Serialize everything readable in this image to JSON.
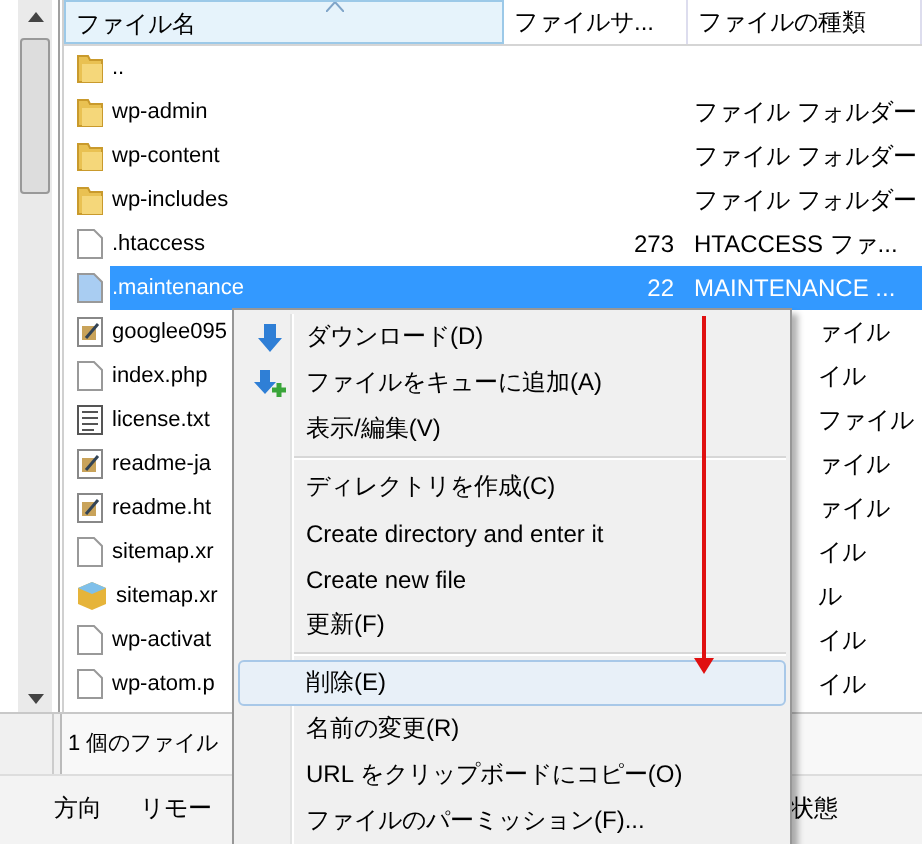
{
  "columns": [
    "ファイル名",
    "ファイルサ...",
    "ファイルの種類"
  ],
  "rows": [
    {
      "kind": "folder",
      "name": "..",
      "size": "",
      "type": "",
      "selected": false
    },
    {
      "kind": "folder",
      "name": "wp-admin",
      "size": "",
      "type": "ファイル フォルダー",
      "selected": false
    },
    {
      "kind": "folder",
      "name": "wp-content",
      "size": "",
      "type": "ファイル フォルダー",
      "selected": false
    },
    {
      "kind": "folder",
      "name": "wp-includes",
      "size": "",
      "type": "ファイル フォルダー",
      "selected": false
    },
    {
      "kind": "file",
      "name": ".htaccess",
      "size": "273",
      "type": "HTACCESS ファ...",
      "selected": false
    },
    {
      "kind": "file",
      "name": ".maintenance",
      "size": "22",
      "type": "MAINTENANCE ...",
      "selected": true
    },
    {
      "kind": "script",
      "name": "googlee095",
      "size": "",
      "type": "ァイル",
      "selected": false
    },
    {
      "kind": "file",
      "name": "index.php",
      "size": "",
      "type": "イル",
      "selected": false
    },
    {
      "kind": "text",
      "name": "license.txt",
      "size": "",
      "type": "ファイル",
      "selected": false
    },
    {
      "kind": "script",
      "name": "readme-ja",
      "size": "",
      "type": "ァイル",
      "selected": false
    },
    {
      "kind": "script",
      "name": "readme.ht",
      "size": "",
      "type": "ァイル",
      "selected": false
    },
    {
      "kind": "file",
      "name": "sitemap.xr",
      "size": "",
      "type": "イル",
      "selected": false
    },
    {
      "kind": "package",
      "name": "sitemap.xr",
      "size": "",
      "type": "ル",
      "selected": false
    },
    {
      "kind": "file",
      "name": "wp-activat",
      "size": "",
      "type": "イル",
      "selected": false
    },
    {
      "kind": "file",
      "name": "wp-atom.p",
      "size": "",
      "type": "イル",
      "selected": false
    }
  ],
  "status_bar": "1 個のファイル",
  "bottom_tabs": [
    "方向",
    "リモー",
    "状態"
  ],
  "context_menu": [
    {
      "kind": "item",
      "label": "ダウンロード(D)",
      "selected": false
    },
    {
      "kind": "item",
      "label": "ファイルをキューに追加(A)",
      "selected": false
    },
    {
      "kind": "item",
      "label": "表示/編集(V)",
      "selected": false
    },
    {
      "kind": "separator"
    },
    {
      "kind": "item",
      "label": "ディレクトリを作成(C)",
      "selected": false
    },
    {
      "kind": "item",
      "label": "Create directory and enter it",
      "selected": false
    },
    {
      "kind": "item",
      "label": "Create new file",
      "selected": false
    },
    {
      "kind": "item",
      "label": "更新(F)",
      "selected": false
    },
    {
      "kind": "separator"
    },
    {
      "kind": "item",
      "label": "削除(E)",
      "selected": true
    },
    {
      "kind": "item",
      "label": "名前の変更(R)",
      "selected": false
    },
    {
      "kind": "item",
      "label": "URL をクリップボードにコピー(O)",
      "selected": false
    },
    {
      "kind": "item",
      "label": "ファイルのパーミッション(F)...",
      "selected": false
    }
  ]
}
